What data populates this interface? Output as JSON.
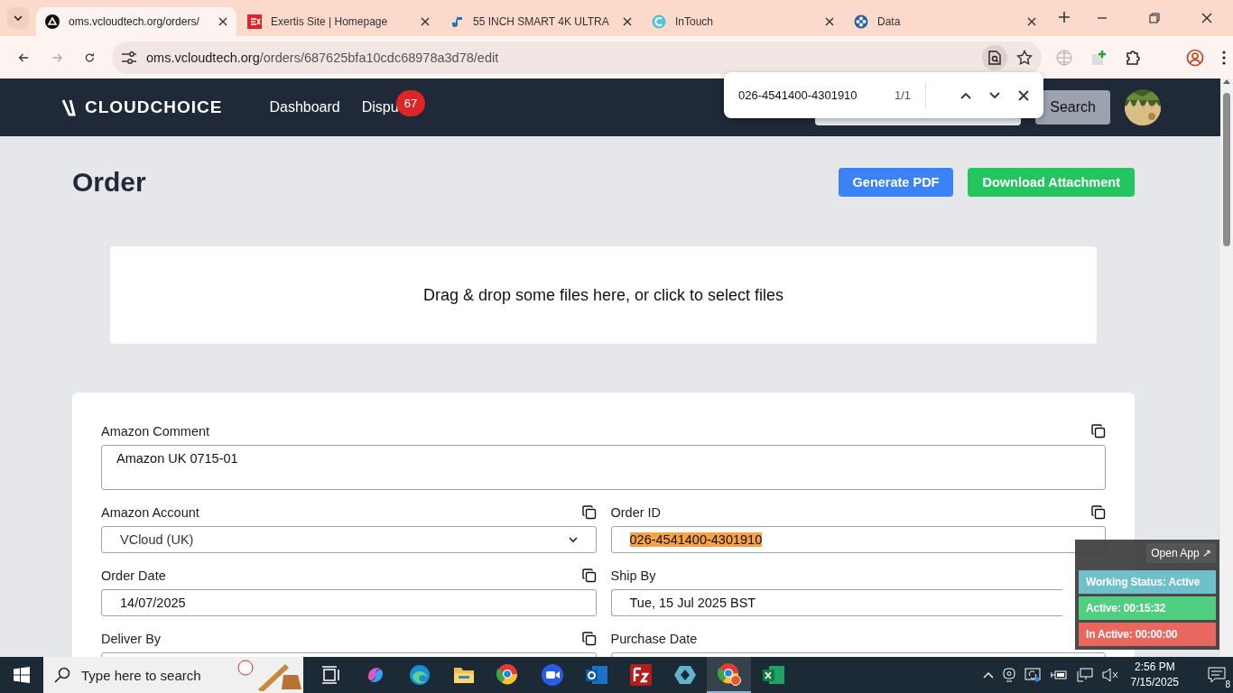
{
  "browser": {
    "tabs": [
      {
        "title": "oms.vcloudtech.org/orders/",
        "selected": true
      },
      {
        "title": "Exertis Site | Homepage",
        "selected": false
      },
      {
        "title": "55 INCH SMART 4K ULTRA",
        "selected": false
      },
      {
        "title": "InTouch",
        "selected": false
      },
      {
        "title": "Data",
        "selected": false
      }
    ],
    "url_host": "oms.vcloudtech.org",
    "url_path": "/orders/687625bfa10cdc68978a3d78/edit",
    "find_bar": {
      "query": "026-4541400-4301910",
      "count": "1/1"
    }
  },
  "app": {
    "logo": "CLOUDCHOICE",
    "nav": [
      {
        "label": "Dashboard"
      },
      {
        "label": "Dispu",
        "badge": "67"
      }
    ],
    "search_button": "Search"
  },
  "page": {
    "title": "Order",
    "buttons": [
      {
        "label": "Generate PDF",
        "kind": "primary"
      },
      {
        "label": "Download Attachment",
        "kind": "success"
      }
    ],
    "dropzone": "Drag & drop some files here, or click to select files",
    "fields": [
      {
        "label": "Amazon Comment",
        "kind": "textarea",
        "value": "Amazon UK 0715-01",
        "copy": true,
        "highlighted": false
      },
      {
        "label": "Amazon Account",
        "kind": "select",
        "value": "VCloud (UK)",
        "copy": true,
        "highlighted": false
      },
      {
        "label": "Order ID",
        "kind": "input",
        "value": "026-4541400-4301910",
        "copy": true,
        "highlighted": true
      },
      {
        "label": "Order Date",
        "kind": "input",
        "value": "14/07/2025",
        "copy": true,
        "highlighted": false
      },
      {
        "label": "Ship By",
        "kind": "input",
        "value": "Tue, 15 Jul 2025 BST",
        "copy": false,
        "highlighted": false
      },
      {
        "label": "Deliver By",
        "kind": "input",
        "copy": true
      },
      {
        "label": "Purchase Date",
        "kind": "input",
        "copy": false
      }
    ]
  },
  "widget": {
    "open_app": "Open App ↗",
    "rows": [
      {
        "text": "Working Status: Active",
        "color": "#6fbfcc"
      },
      {
        "text": "Active: 00:15:32",
        "color": "#4fcf7f"
      },
      {
        "text": "In Active: 00:00:00",
        "color": "#e8675f"
      }
    ]
  },
  "taskbar": {
    "search_placeholder": "Type here to search",
    "apps": [
      {
        "kind": "taskview",
        "active": false
      },
      {
        "kind": "swirl",
        "active": false
      },
      {
        "kind": "wave",
        "active": false
      },
      {
        "kind": "folder",
        "active": false
      },
      {
        "kind": "ring",
        "active": false
      },
      {
        "kind": "camera",
        "active": false
      },
      {
        "kind": "mail",
        "active": false
      },
      {
        "kind": "redsquare",
        "active": false
      },
      {
        "kind": "diamond",
        "active": false
      },
      {
        "kind": "ringprofile",
        "active": true
      },
      {
        "kind": "sheet",
        "active": false
      }
    ],
    "time": "2:56 PM",
    "date": "7/15/2025",
    "notifications": "8"
  }
}
